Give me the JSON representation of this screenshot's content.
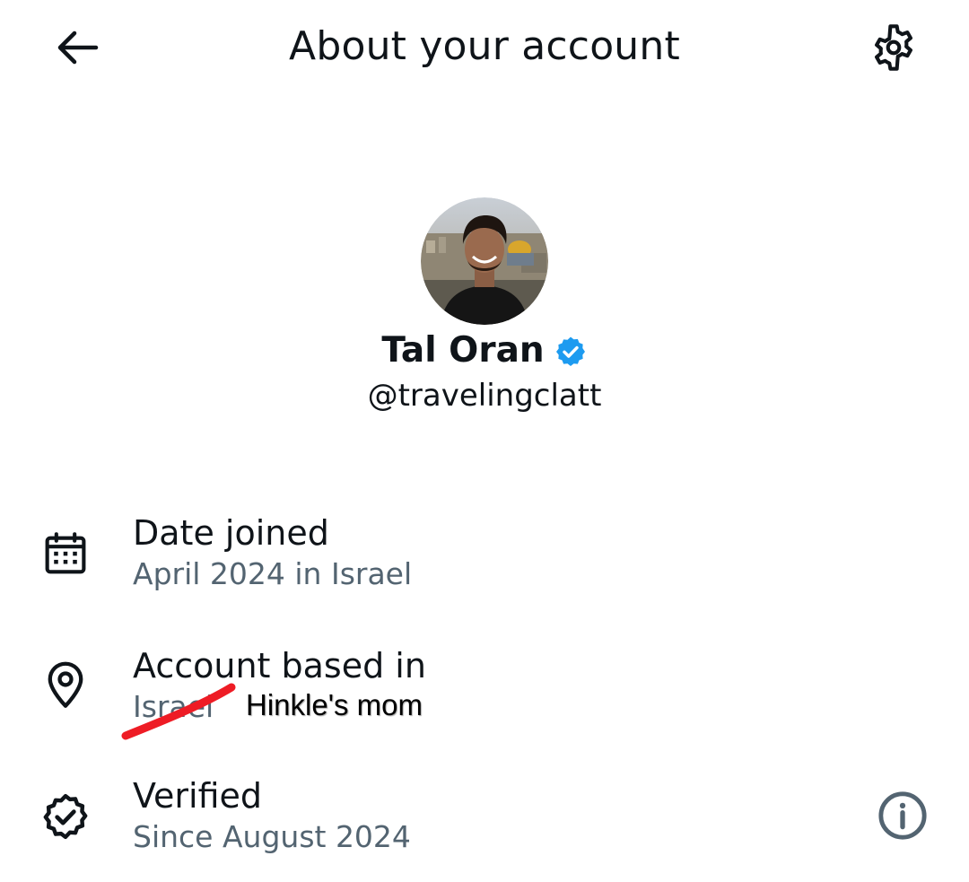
{
  "header": {
    "title": "About your account",
    "back_icon": "arrow-left-icon",
    "settings_icon": "gear-icon"
  },
  "profile": {
    "display_name": "Tal Oran",
    "handle": "@travelingclatt",
    "verified_badge_color": "#1d9bf0"
  },
  "rows": [
    {
      "icon": "calendar-icon",
      "title": "Date joined",
      "subtitle": "April 2024 in Israel"
    },
    {
      "icon": "location-pin-icon",
      "title": "Account based in",
      "subtitle": "Israel"
    },
    {
      "icon": "verified-check-icon",
      "title": "Verified",
      "subtitle": "Since August 2024",
      "action_icon": "info-icon"
    }
  ],
  "annotation": {
    "text": "Hinkle's mom",
    "strike_color": "#ee1c25"
  },
  "colors": {
    "primary_text": "#0f1419",
    "secondary_text": "#536471",
    "accent": "#1d9bf0"
  }
}
